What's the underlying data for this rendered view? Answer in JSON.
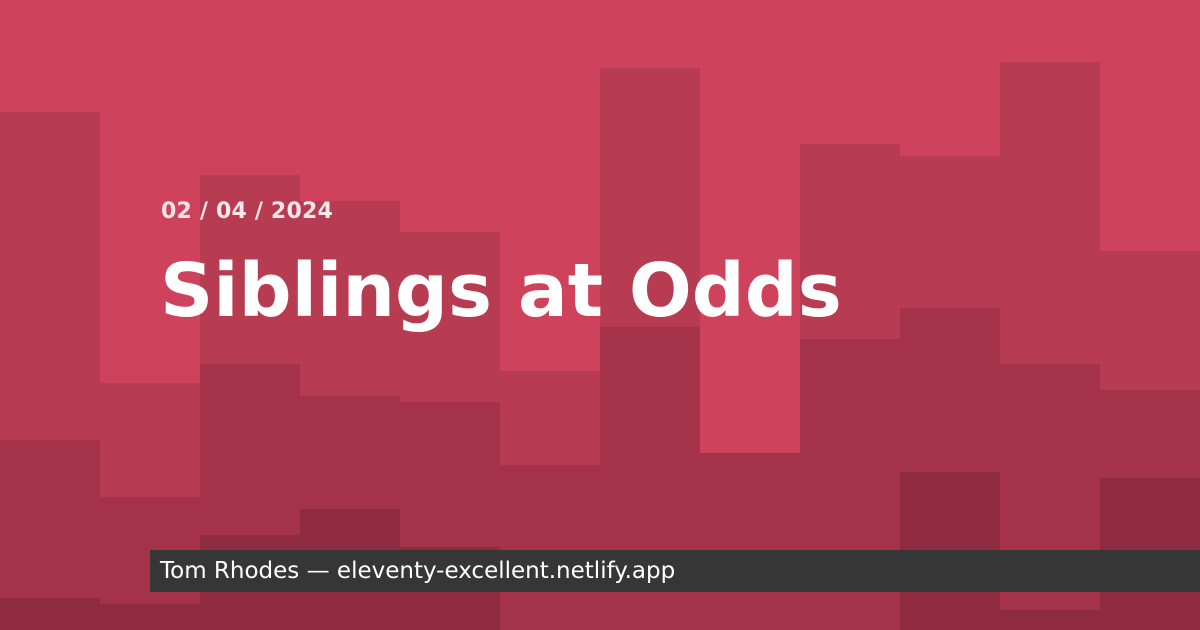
{
  "post": {
    "date": "02 / 04 / 2024",
    "title": "Siblings at Odds"
  },
  "footer": {
    "byline": "Tom Rhodes — eleventy-excellent.netlify.app"
  },
  "colors": {
    "background": "#cf425c",
    "band_1": "#b73b51",
    "band_2": "#a43349",
    "band_3": "#8e2b40",
    "footer_bar": "#363636",
    "title_text": "#ffffff"
  }
}
